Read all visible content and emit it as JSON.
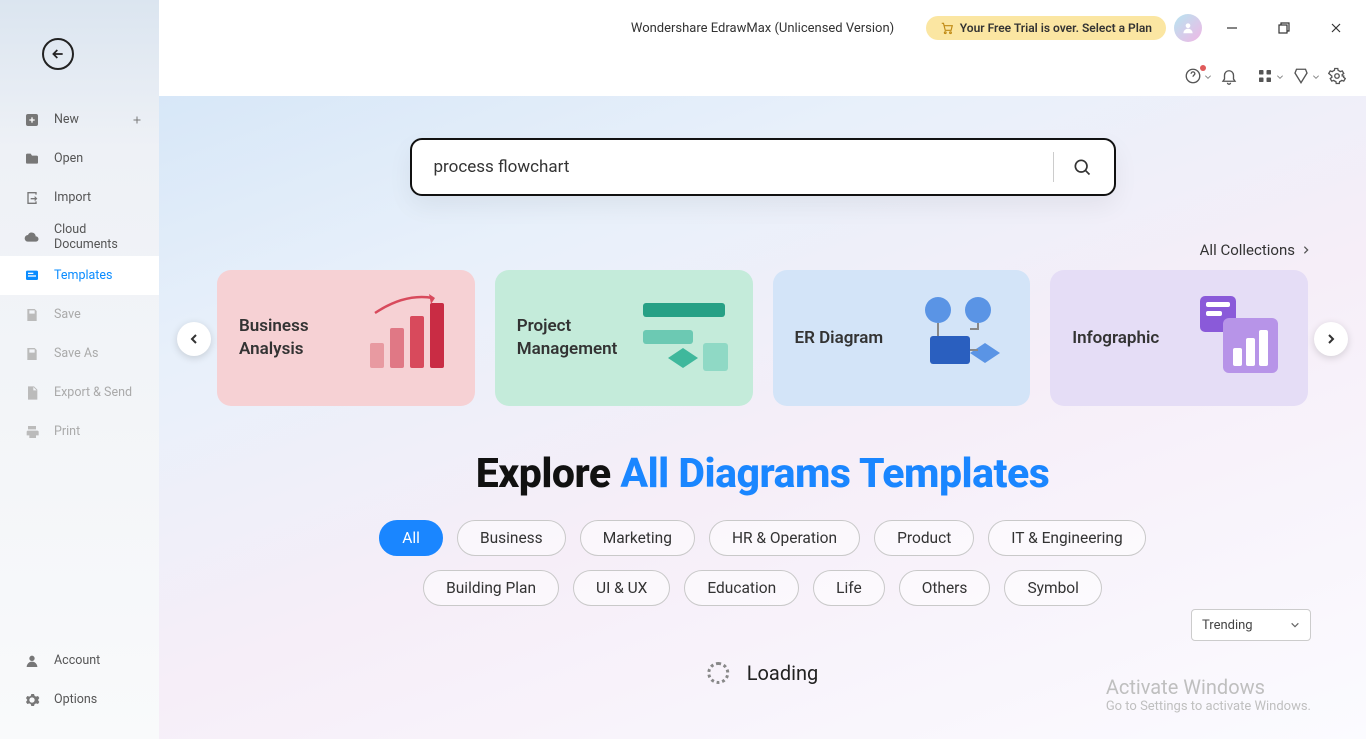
{
  "titlebar": {
    "title": "Wondershare EdrawMax (Unlicensed Version)",
    "trial_text": "Your Free Trial is over. Select a Plan"
  },
  "sidebar": {
    "items": [
      {
        "label": "New",
        "icon": "plus-square",
        "enabled": true,
        "has_plus": true
      },
      {
        "label": "Open",
        "icon": "folder",
        "enabled": true
      },
      {
        "label": "Import",
        "icon": "import",
        "enabled": true
      },
      {
        "label": "Cloud Documents",
        "icon": "cloud",
        "enabled": true
      },
      {
        "label": "Templates",
        "icon": "templates",
        "enabled": true,
        "active": true
      },
      {
        "label": "Save",
        "icon": "save",
        "enabled": false
      },
      {
        "label": "Save As",
        "icon": "save-as",
        "enabled": false
      },
      {
        "label": "Export & Send",
        "icon": "export",
        "enabled": false
      },
      {
        "label": "Print",
        "icon": "print",
        "enabled": false
      }
    ],
    "bottom": [
      {
        "label": "Account",
        "icon": "account"
      },
      {
        "label": "Options",
        "icon": "gear"
      }
    ]
  },
  "main": {
    "search_value": "process flowchart",
    "all_collections": "All Collections",
    "cards": [
      {
        "title": "Business Analysis"
      },
      {
        "title": "Project Management"
      },
      {
        "title": "ER Diagram"
      },
      {
        "title": "Infographic"
      }
    ],
    "heading_prefix": "Explore ",
    "heading_highlight": "All Diagrams Templates",
    "filters": [
      "All",
      "Business",
      "Marketing",
      "HR & Operation",
      "Product",
      "IT & Engineering",
      "Building Plan",
      "UI & UX",
      "Education",
      "Life",
      "Others",
      "Symbol"
    ],
    "filter_active_index": 0,
    "sort_value": "Trending",
    "loading_text": "Loading"
  },
  "watermark": {
    "line1": "Activate Windows",
    "line2": "Go to Settings to activate Windows."
  }
}
